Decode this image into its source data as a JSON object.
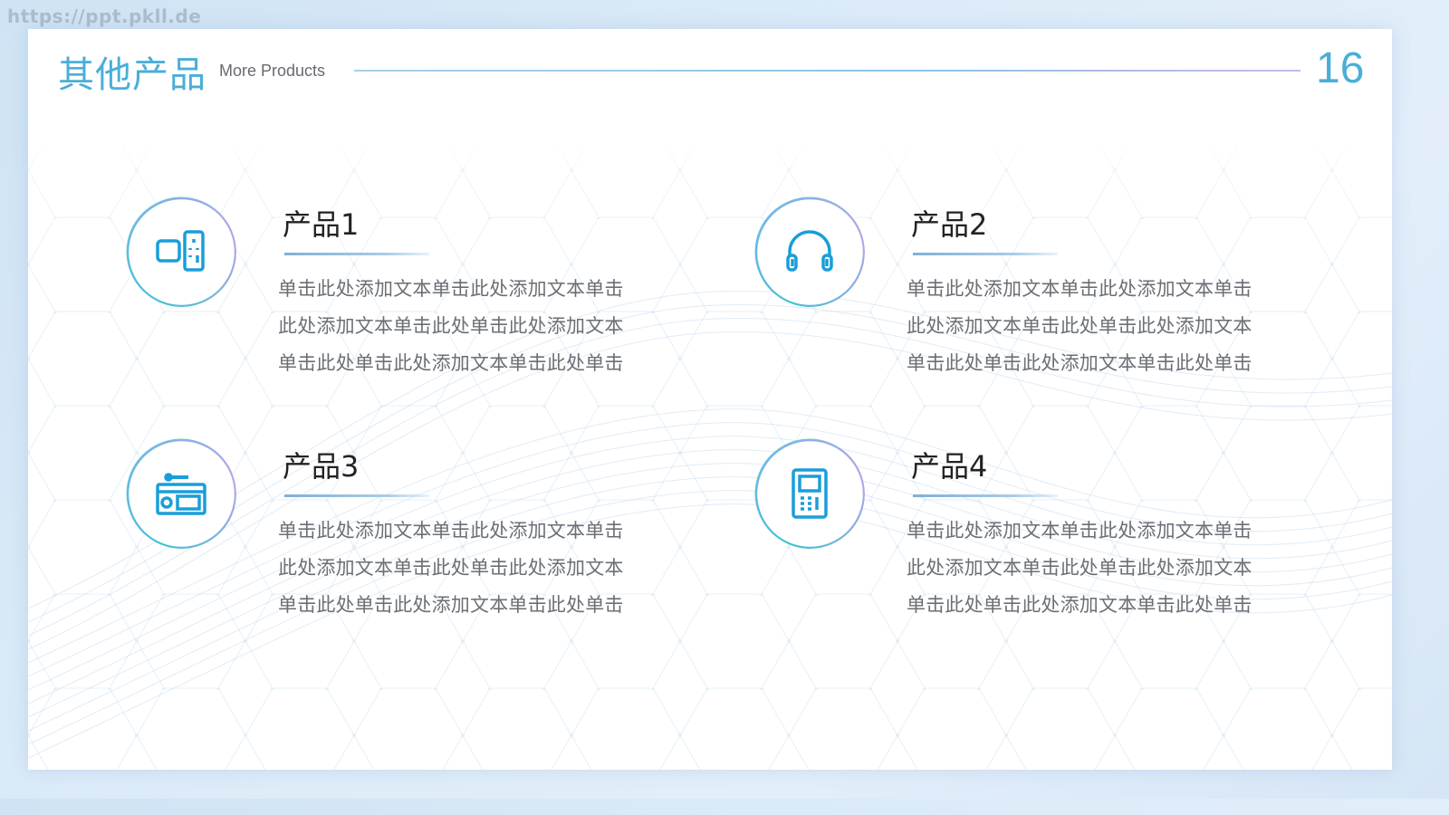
{
  "watermark": "https://ppt.pkll.de",
  "header": {
    "title": "其他产品",
    "subtitle": "More Products",
    "page_number": "16"
  },
  "colors": {
    "accent": "#4aaed8",
    "icon_blue": "#1a9ed9",
    "text_dark": "#222222",
    "text_body": "#6b6f75"
  },
  "products": [
    {
      "title": "产品1",
      "icon": "tv-remote-icon",
      "lines": [
        "单击此处添加文本单击此处添加文本单击",
        "此处添加文本单击此处单击此处添加文本",
        "单击此处单击此处添加文本单击此处单击"
      ]
    },
    {
      "title": "产品2",
      "icon": "headphones-icon",
      "lines": [
        "单击此处添加文本单击此处添加文本单击",
        "此处添加文本单击此处单击此处添加文本",
        "单击此处单击此处添加文本单击此处单击"
      ]
    },
    {
      "title": "产品3",
      "icon": "oven-icon",
      "lines": [
        "单击此处添加文本单击此处添加文本单击",
        "此处添加文本单击此处单击此处添加文本",
        "单击此处单击此处添加文本单击此处单击"
      ]
    },
    {
      "title": "产品4",
      "icon": "intercom-icon",
      "lines": [
        "单击此处添加文本单击此处添加文本单击",
        "此处添加文本单击此处单击此处添加文本",
        "单击此处单击此处添加文本单击此处单击"
      ]
    }
  ]
}
